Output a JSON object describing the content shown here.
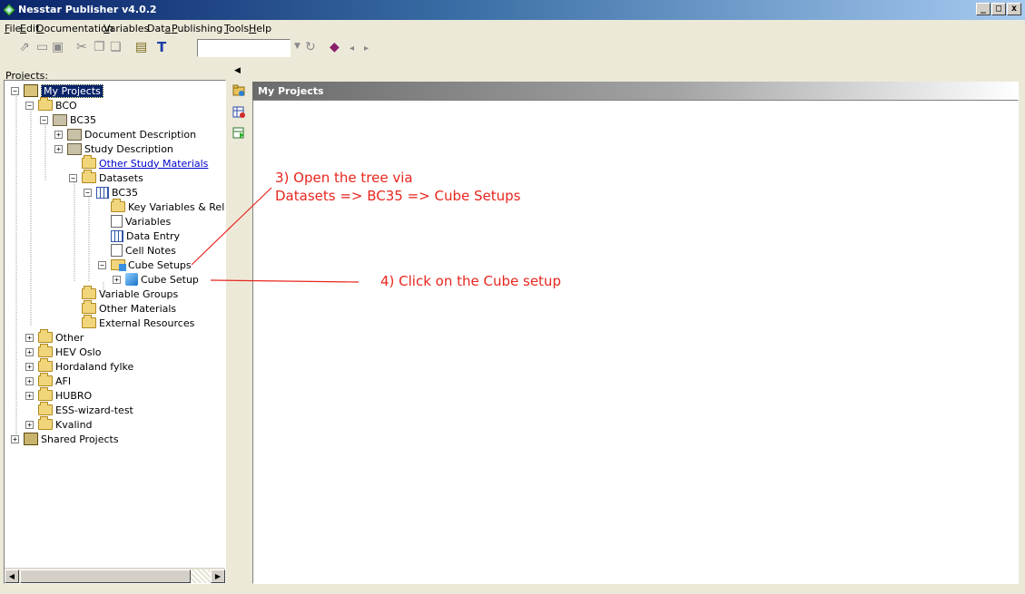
{
  "window": {
    "title": "Nesstar Publisher v4.0.2",
    "minimize_label": "_",
    "restore_label": "□",
    "close_label": "x"
  },
  "menus": [
    {
      "u": "F",
      "rest": "ile"
    },
    {
      "u": "E",
      "rest": "dit"
    },
    {
      "u": "D",
      "rest": "ocumentation"
    },
    {
      "u": "V",
      "rest": "ariables"
    },
    {
      "pre": "Dat",
      "u": "a",
      "rest": ""
    },
    {
      "u": "P",
      "rest": "ublishing"
    },
    {
      "u": "T",
      "rest": "ools"
    },
    {
      "u": "H",
      "rest": "elp"
    }
  ],
  "toolbar": {
    "combo_value": "",
    "icons": [
      "open-icon",
      "new-icon",
      "save-icon",
      "cut-icon",
      "copy-icon",
      "paste-icon",
      "project-icon",
      "text-t-icon",
      "refresh-icon",
      "book-icon",
      "back-icon",
      "forward-icon"
    ]
  },
  "projects_label": "Projects:",
  "tree": [
    {
      "label": "My Projects",
      "exp": "-",
      "icon": "project",
      "selected": true
    },
    {
      "label": "BCO",
      "exp": "-",
      "icon": "folder"
    },
    {
      "label": "BC35",
      "exp": "-",
      "icon": "book"
    },
    {
      "label": "Document Description",
      "exp": "+",
      "icon": "book"
    },
    {
      "label": "Study Description",
      "exp": "+",
      "icon": "book"
    },
    {
      "label": "Other Study Materials",
      "exp": "",
      "icon": "folder",
      "link": true
    },
    {
      "label": "Datasets",
      "exp": "-",
      "icon": "folder"
    },
    {
      "label": "BC35",
      "exp": "-",
      "icon": "table"
    },
    {
      "label": "Key Variables & Rela",
      "exp": "",
      "icon": "folder"
    },
    {
      "label": "Variables",
      "exp": "",
      "icon": "doc"
    },
    {
      "label": "Data Entry",
      "exp": "",
      "icon": "table"
    },
    {
      "label": "Cell Notes",
      "exp": "",
      "icon": "doc"
    },
    {
      "label": "Cube Setups",
      "exp": "-",
      "icon": "cubefolder"
    },
    {
      "label": "Cube Setup",
      "exp": "+",
      "icon": "cube"
    },
    {
      "label": "Variable Groups",
      "exp": "",
      "icon": "folder"
    },
    {
      "label": "Other Materials",
      "exp": "",
      "icon": "folder"
    },
    {
      "label": "External Resources",
      "exp": "",
      "icon": "folder"
    },
    {
      "label": "Other",
      "exp": "+",
      "icon": "folder"
    },
    {
      "label": "HEV Oslo",
      "exp": "+",
      "icon": "folder"
    },
    {
      "label": "Hordaland fylke",
      "exp": "+",
      "icon": "folder"
    },
    {
      "label": "AFI",
      "exp": "+",
      "icon": "folder"
    },
    {
      "label": "HUBRO",
      "exp": "+",
      "icon": "folder"
    },
    {
      "label": "ESS-wizard-test",
      "exp": "",
      "icon": "folder"
    },
    {
      "label": "Kvalind",
      "exp": "+",
      "icon": "folder"
    },
    {
      "label": "Shared Projects",
      "exp": "+",
      "icon": "shared"
    }
  ],
  "side_icons": [
    "add-folder-icon",
    "add-dataset-icon",
    "import-icon"
  ],
  "main": {
    "header": "My Projects"
  },
  "annotations": {
    "step3_line1": "3) Open the tree via",
    "step3_line2": "Datasets => BC35 => Cube Setups",
    "step4": "4) Click on the Cube setup"
  },
  "colors": {
    "annotation": "#e8261f",
    "selection": "#0a246a"
  }
}
